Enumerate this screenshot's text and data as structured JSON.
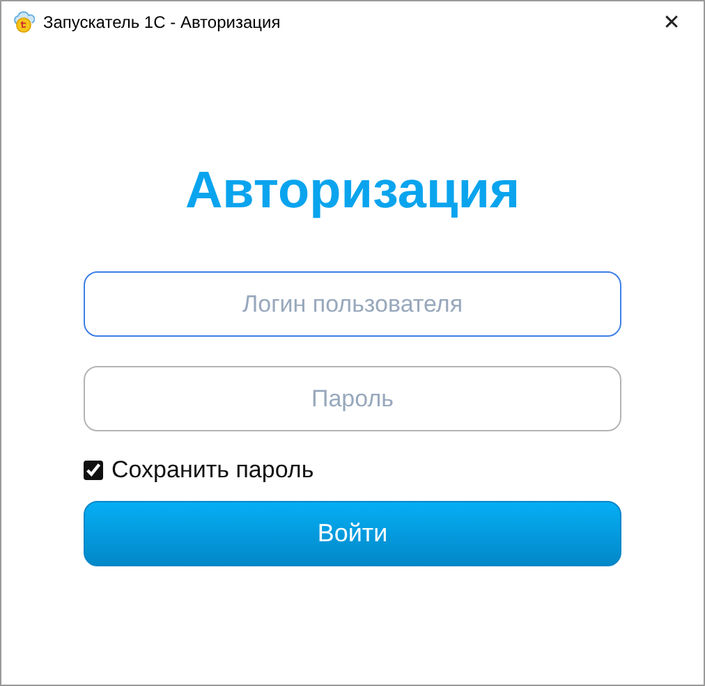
{
  "window": {
    "title": "Запускатель 1С - Авторизация",
    "close": "✕"
  },
  "heading": "Авторизация",
  "fields": [
    {
      "placeholder": "Логин пользователя",
      "focused": true
    },
    {
      "placeholder": "Пароль",
      "focused": false
    }
  ],
  "remember": {
    "label": "Сохранить пароль",
    "checked": true
  },
  "submit": "Войти"
}
